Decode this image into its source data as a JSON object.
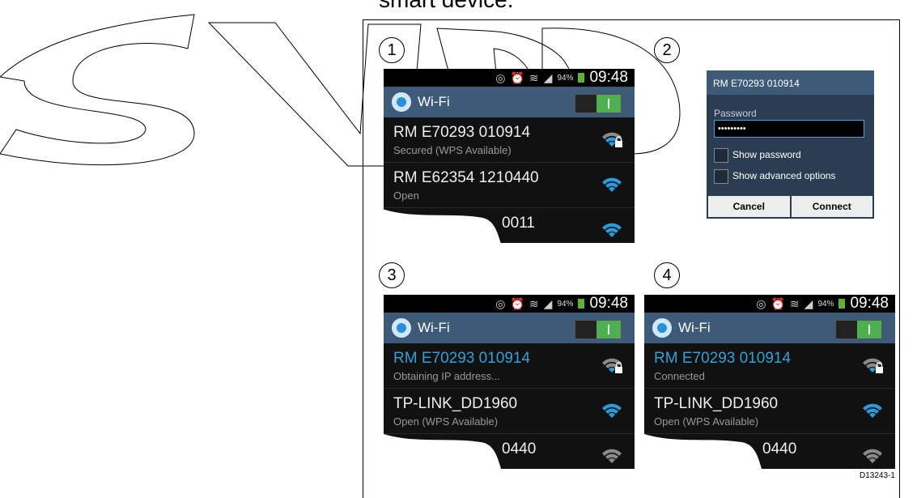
{
  "heading": "smart device.",
  "figure_code": "D13243-1",
  "steps": [
    "1",
    "2",
    "3",
    "4"
  ],
  "status_bar": {
    "battery_pct": "94%",
    "time": "09:48",
    "icons": [
      "eye-icon",
      "alarm-icon",
      "wifi-status-icon",
      "signal-icon",
      "battery-icon"
    ]
  },
  "wifi_header": {
    "title": "Wi-Fi"
  },
  "screen1": {
    "networks": [
      {
        "name": "RM E70293 010914",
        "sub": "Secured (WPS Available)",
        "signal": "wifi-lock-icon",
        "state": "normal"
      },
      {
        "name": "RM E62354 1210440",
        "sub": "Open",
        "signal": "wifi-icon",
        "state": "normal"
      },
      {
        "name": "0011",
        "sub": "",
        "signal": "wifi-icon",
        "state": "partial"
      }
    ]
  },
  "dialog": {
    "title": "RM E70293 010914",
    "password_label": "Password",
    "password_value": "•••••••••",
    "show_password": "Show password",
    "show_advanced": "Show advanced options",
    "cancel": "Cancel",
    "connect": "Connect"
  },
  "screen3": {
    "networks": [
      {
        "name": "RM E70293 010914",
        "sub": "Obtaining IP address...",
        "signal": "wifi-lock-icon",
        "state": "connected"
      },
      {
        "name": "TP-LINK_DD1960",
        "sub": "Open (WPS Available)",
        "signal": "wifi-icon",
        "state": "normal"
      },
      {
        "name": "0440",
        "sub": "",
        "signal": "wifi-icon",
        "state": "partial"
      }
    ]
  },
  "screen4": {
    "networks": [
      {
        "name": "RM E70293 010914",
        "sub": "Connected",
        "signal": "wifi-lock-icon",
        "state": "connected"
      },
      {
        "name": "TP-LINK_DD1960",
        "sub": "Open (WPS Available)",
        "signal": "wifi-icon",
        "state": "normal"
      },
      {
        "name": "0440",
        "sub": "",
        "signal": "wifi-icon",
        "state": "partial"
      }
    ]
  },
  "colors": {
    "wifi_bar": "#3d5a78",
    "connected_text": "#33a0d6",
    "signal_blue": "#2c9ad8",
    "signal_gray": "#8a8a8a",
    "toggle_on": "#4caf50"
  }
}
